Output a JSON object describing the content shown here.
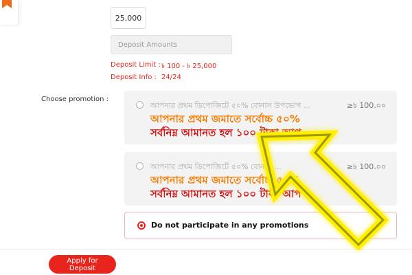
{
  "form": {
    "amount_value": "25,000",
    "deposit_amounts_placeholder": "Deposit Amounts",
    "deposit_limit_label": "Deposit Limit :",
    "deposit_limit_value": "৳ 100 - ৳ 25,000",
    "deposit_info_label": "Deposit Info :",
    "deposit_info_value": "24/24"
  },
  "promotion": {
    "label": "Choose promotion :",
    "options": [
      {
        "title": "আপনার প্রথম ডিপোজিটে ৫০% বোনাস উপভোগ ...",
        "amount": "≥৳ 100.০০",
        "line1": "আপনার প্রথম জমাতে সর্বোচ্চ ৫০%",
        "line2": "সর্বনিম্ন আমানত হল ১০০ টাকা আপ"
      },
      {
        "title": "আপনার প্রথম ডিপোজিটে ৫০% বোনাস ...",
        "amount": "≥৳ 100.০০",
        "line1": "আপনার প্রথম জমাতে সর্বোচ্চ ৫০%",
        "line2": "সর্বনিম্ন আমানত হল ১০০ টাকা আপ"
      }
    ],
    "no_promo_label": "Do not participate in any promotions"
  },
  "actions": {
    "apply_label": "Apply for Deposit"
  },
  "colors": {
    "accent": "#e8251c",
    "promo_orange": "#f57c00",
    "arrow_yellow": "#ffee00"
  }
}
